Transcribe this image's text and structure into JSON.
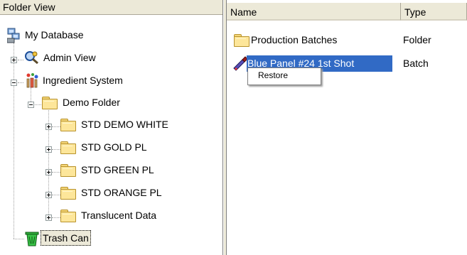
{
  "left_pane": {
    "header": "Folder View",
    "tree": [
      {
        "label": "My Database",
        "icon": "database-icon"
      },
      {
        "label": "Admin View",
        "icon": "admin-view-icon"
      },
      {
        "label": "Ingredient System",
        "icon": "ingredient-system-icon"
      },
      {
        "label": "Demo Folder",
        "icon": "folder-icon"
      },
      {
        "label": "STD DEMO WHITE",
        "icon": "folder-icon"
      },
      {
        "label": "STD GOLD PL",
        "icon": "folder-icon"
      },
      {
        "label": "STD GREEN PL",
        "icon": "folder-icon"
      },
      {
        "label": "STD ORANGE PL",
        "icon": "folder-icon"
      },
      {
        "label": "Translucent Data",
        "icon": "folder-icon"
      },
      {
        "label": "Trash Can",
        "icon": "trash-can-icon"
      }
    ]
  },
  "right_pane": {
    "columns": [
      "Name",
      "Type"
    ],
    "rows": [
      {
        "name": "Production Batches",
        "type": "Folder",
        "icon": "folder-icon"
      },
      {
        "name": "Blue Panel #24 1st Shot",
        "type": "Batch",
        "icon": "batch-icon"
      }
    ]
  },
  "context_menu": {
    "items": [
      "Restore"
    ]
  }
}
